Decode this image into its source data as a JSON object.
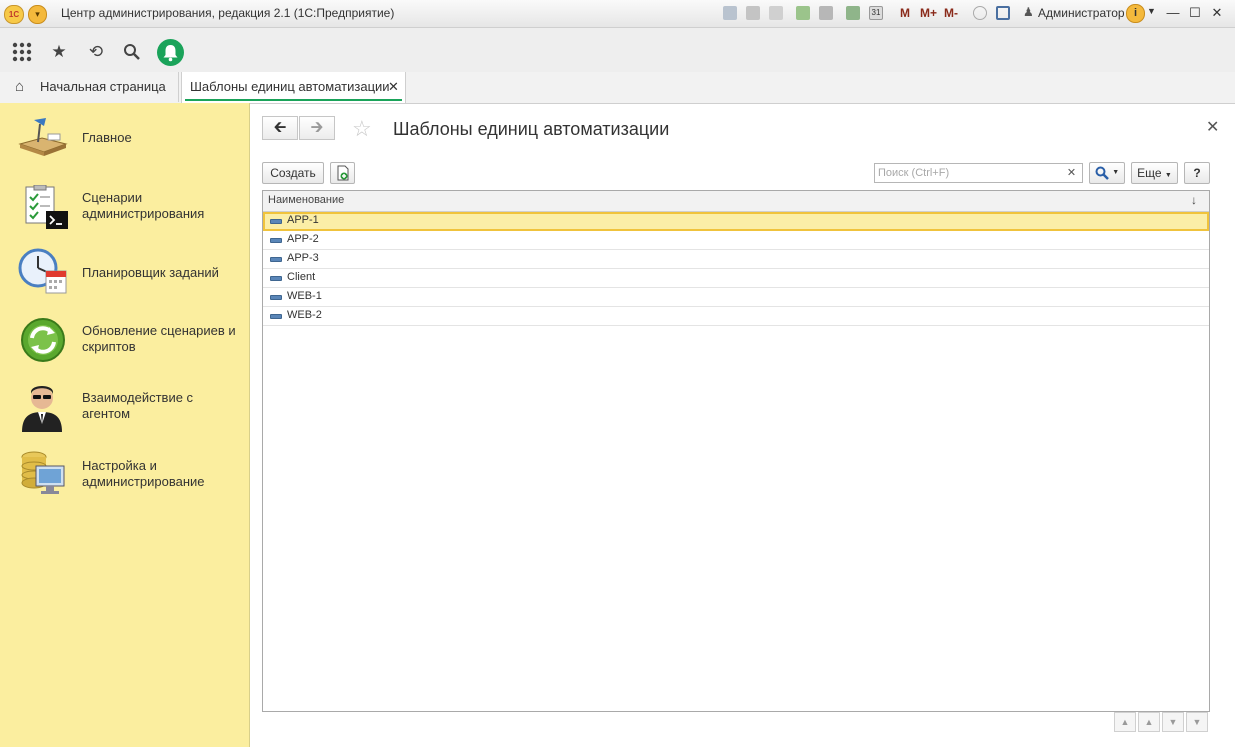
{
  "window": {
    "title": "Центр администрирования, редакция 2.1  (1С:Предприятие)",
    "logo_text": "1С",
    "memory_buttons": [
      "M",
      "M+",
      "M-"
    ],
    "user": "Администратор"
  },
  "tabs": [
    {
      "label": "Начальная страница"
    },
    {
      "label": "Шаблоны единиц автоматизации"
    }
  ],
  "sidebar": {
    "items": [
      {
        "label": "Главное",
        "icon": "desk-lamp-icon"
      },
      {
        "label": "Сценарии администрирования",
        "icon": "checklist-terminal-icon"
      },
      {
        "label": "Планировщик заданий",
        "icon": "clock-calendar-icon"
      },
      {
        "label": "Обновление сценариев и скриптов",
        "icon": "refresh-globe-icon"
      },
      {
        "label": "Взаимодействие с агентом",
        "icon": "agent-person-icon"
      },
      {
        "label": "Настройка и администрирование",
        "icon": "database-monitor-icon"
      }
    ]
  },
  "form": {
    "title": "Шаблоны единиц автоматизации",
    "create_label": "Создать",
    "search_placeholder": "Поиск (Ctrl+F)",
    "more_label": "Еще",
    "help_label": "?"
  },
  "table": {
    "column": "Наименование",
    "rows": [
      "APP-1",
      "APP-2",
      "APP-3",
      "Client",
      "WEB-1",
      "WEB-2"
    ],
    "selected_row": "APP-1"
  },
  "colors": {
    "sidebar_bg": "#fbee9f",
    "accent_green": "#1aa35a",
    "selection_border": "#f0c33c"
  }
}
